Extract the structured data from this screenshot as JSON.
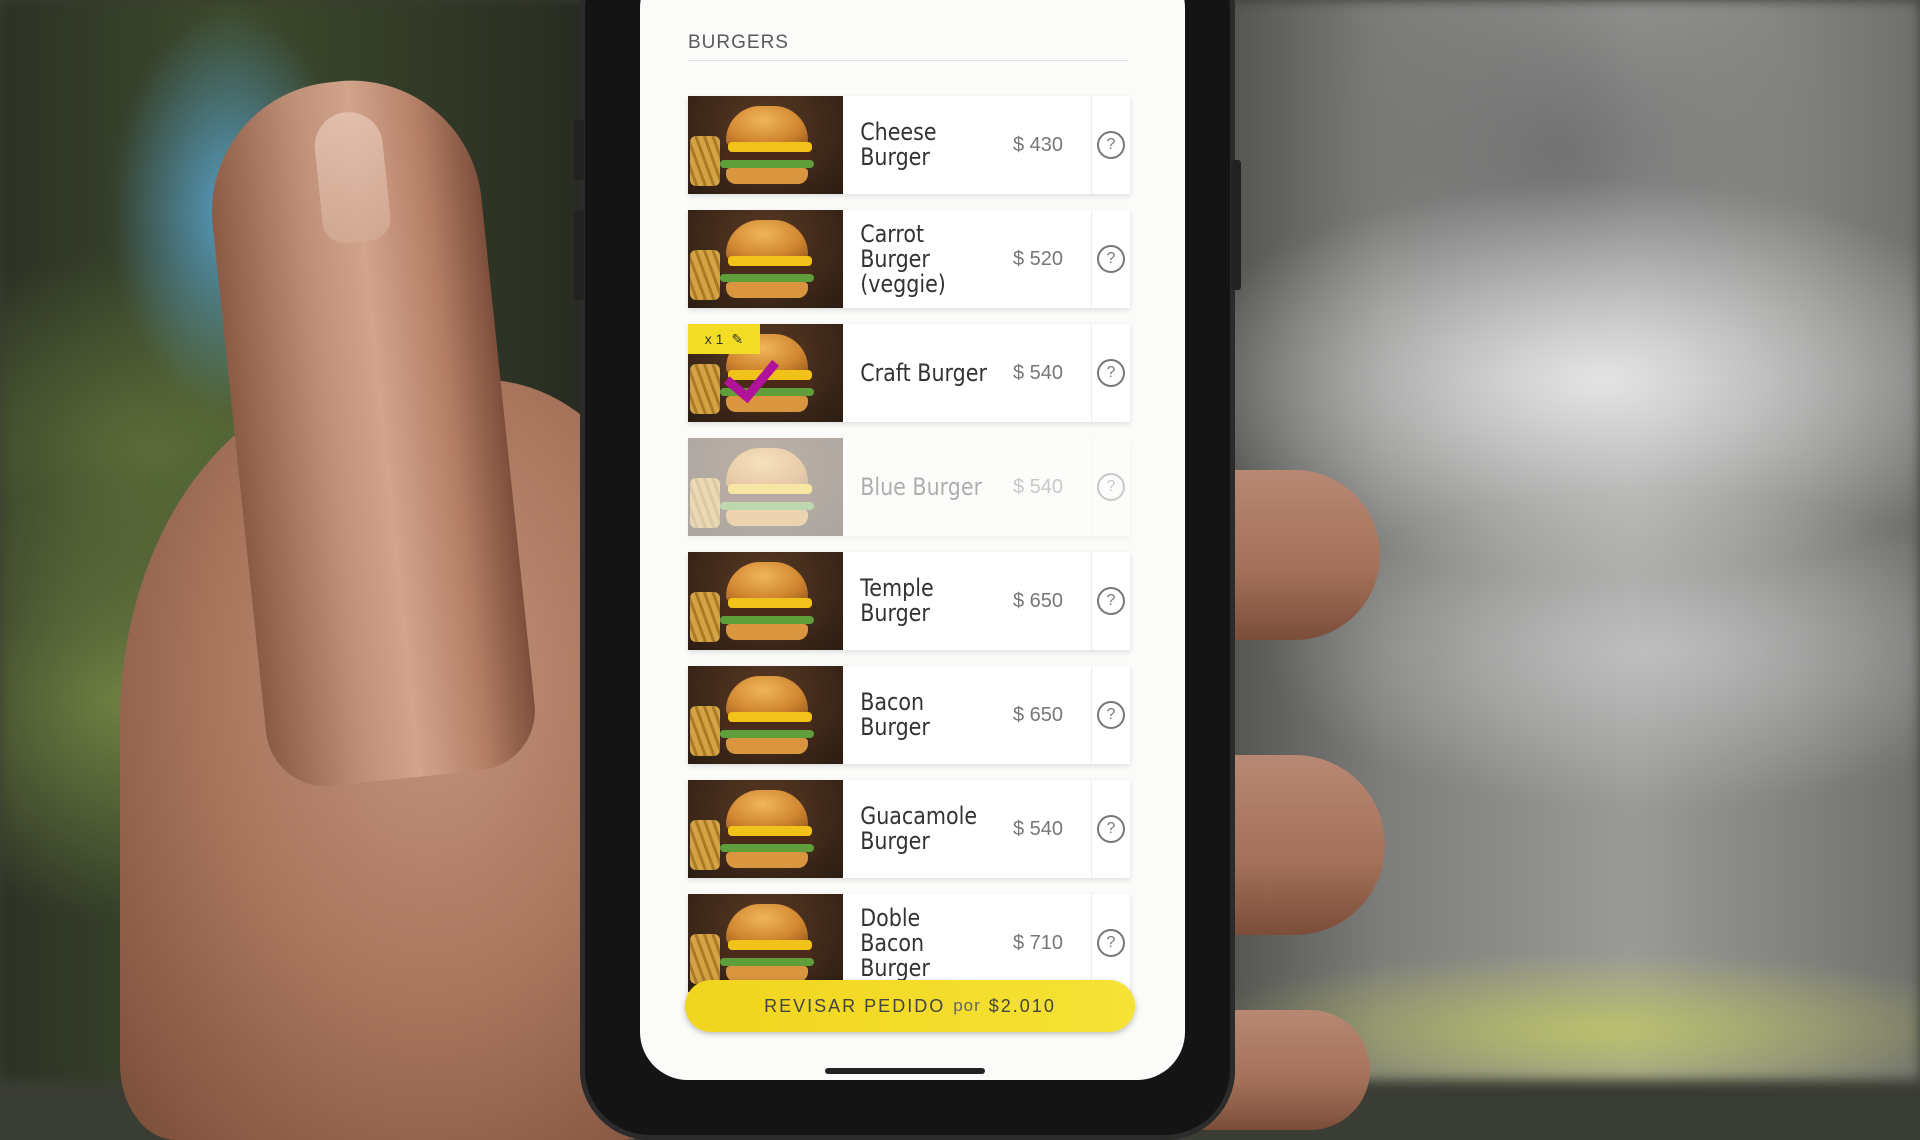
{
  "section": {
    "title": "BURGERS"
  },
  "menu_items": [
    {
      "name": "Cheese Burger",
      "price": "$ 430",
      "selected": false,
      "dimmed": false
    },
    {
      "name": "Carrot Burger (veggie)",
      "price": "$ 520",
      "selected": false,
      "dimmed": false
    },
    {
      "name": "Craft Burger",
      "price": "$ 540",
      "selected": true,
      "quantity": "x 1",
      "dimmed": false
    },
    {
      "name": "Blue Burger",
      "price": "$ 540",
      "selected": false,
      "dimmed": true
    },
    {
      "name": "Temple Burger",
      "price": "$ 650",
      "selected": false,
      "dimmed": false
    },
    {
      "name": "Bacon Burger",
      "price": "$ 650",
      "selected": false,
      "dimmed": false
    },
    {
      "name": "Guacamole Burger",
      "price": "$ 540",
      "selected": false,
      "dimmed": false
    },
    {
      "name": "Doble Bacon Burger",
      "price": "$ 710",
      "selected": false,
      "dimmed": false
    }
  ],
  "help_symbol": "?",
  "edit_icon_glyph": "✎",
  "order_button": {
    "label": "REVISAR PEDIDO",
    "by": "por",
    "total": "$2.010"
  },
  "colors": {
    "accent_yellow": "#f3dc24",
    "check_magenta": "#b0139a"
  }
}
